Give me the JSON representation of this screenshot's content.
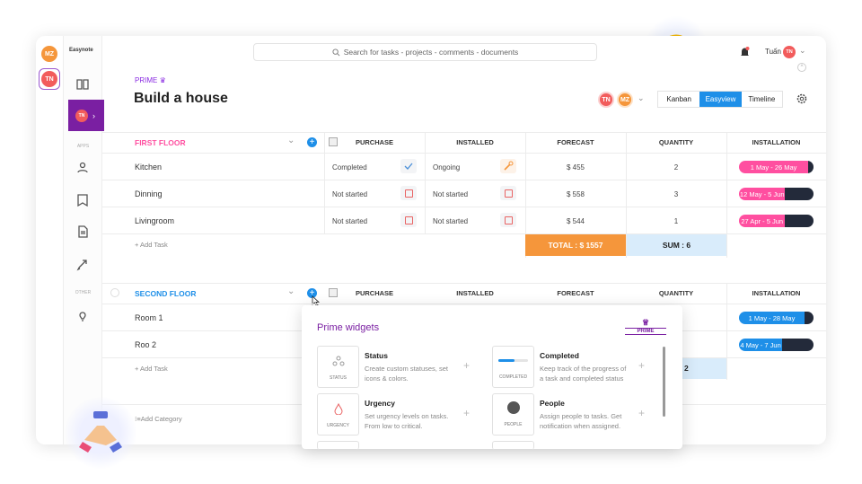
{
  "app": {
    "logo": "Easynote"
  },
  "users": {
    "mz": "MZ",
    "tn": "TN",
    "user_name": "Tuấn"
  },
  "sidebar": {
    "apps_label": "APPS",
    "other_label": "OTHER"
  },
  "search": {
    "placeholder": "Search for tasks - projects - comments - documents"
  },
  "project": {
    "badge": "PRIME",
    "title": "Build a house"
  },
  "views": {
    "kanban": "Kanban",
    "easyview": "Easyview",
    "timeline": "Timeline"
  },
  "columns": {
    "purchase": "PURCHASE",
    "installed": "INSTALLED",
    "forecast": "FORECAST",
    "quantity": "QUANTITY",
    "installation": "INSTALLATION"
  },
  "first_floor": {
    "name": "FIRST FLOOR",
    "rows": [
      {
        "name": "Kitchen",
        "purchase": "Completed",
        "installed": "Ongoing",
        "forecast": "$ 455",
        "quantity": "2",
        "installation": "1 May - 26 May",
        "fill": 0.93
      },
      {
        "name": "Dinning",
        "purchase": "Not started",
        "installed": "Not started",
        "forecast": "$ 558",
        "quantity": "3",
        "installation": "12 May - 5 Jun",
        "fill": 0.62
      },
      {
        "name": "Livingroom",
        "purchase": "Not started",
        "installed": "Not started",
        "forecast": "$ 544",
        "quantity": "1",
        "installation": "27 Apr - 5 Jun",
        "fill": 0.62
      }
    ],
    "add_task": "+ Add Task",
    "total": "TOTAL : $ 1557",
    "sum": "SUM : 6"
  },
  "second_floor": {
    "name": "SECOND FLOOR",
    "rows": [
      {
        "name": "Room 1",
        "installation": "1 May - 28 May",
        "fill": 0.88
      },
      {
        "name": "Roo 2",
        "installation": "4 May - 7 Jun",
        "fill": 0.58
      }
    ],
    "add_task": "+ Add Task",
    "sum_partial": "2"
  },
  "add_category": "Add Category",
  "prime_widgets": {
    "title": "Prime widgets",
    "logo_text": "PRIME",
    "items": [
      {
        "tile": "STATUS",
        "title": "Status",
        "desc1": "Create custom statuses, set",
        "desc2": "icons & colors."
      },
      {
        "tile": "COMPLETED",
        "title": "Completed",
        "desc1": "Keep track of the progress of",
        "desc2": "a task and completed status"
      },
      {
        "tile": "URGENCY",
        "title": "Urgency",
        "desc1": "Set urgency levels on tasks.",
        "desc2": "From low to critical."
      },
      {
        "tile": "PEOPLE",
        "title": "People",
        "desc1": "Assign people to tasks. Get",
        "desc2": "notification when assigned."
      }
    ]
  },
  "colors": {
    "pink": "#ff4fa0",
    "blue": "#1e8fe8",
    "orange": "#f5963b",
    "lightblue": "#d9ecfb",
    "purple": "#7a1fa2"
  }
}
